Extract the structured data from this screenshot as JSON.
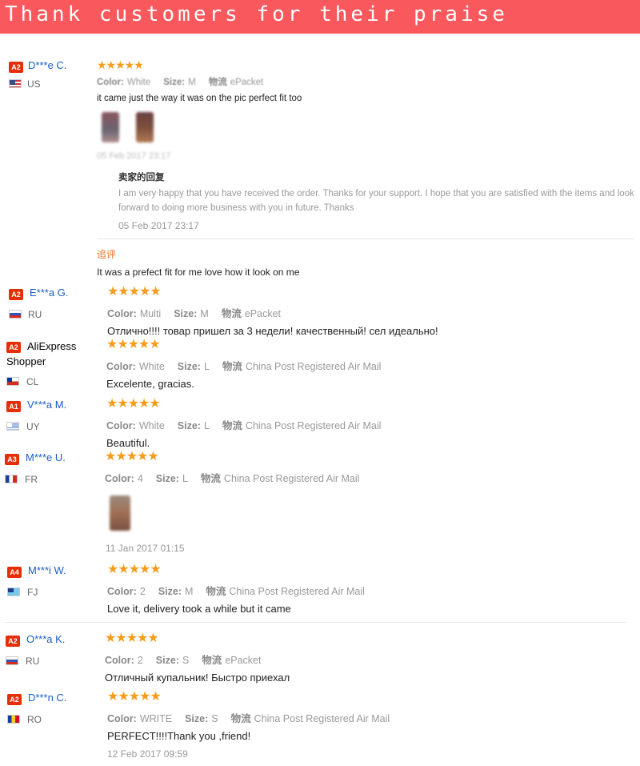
{
  "banner": {
    "title": "Thank customers for their praise"
  },
  "labels": {
    "color": "Color:",
    "size": "Size:",
    "shipping": "物流"
  },
  "reviews": [
    {
      "badge": "A2",
      "name": "D***e C.",
      "country": "US",
      "stars": "★★★★★",
      "color": "White",
      "size": "M",
      "shipping": "ePacket",
      "text": "it came just the way it was on the pic perfect fit too",
      "date": "05 Feb 2017 23:17",
      "seller_reply": {
        "title": "卖家的回复",
        "text": "I am very happy that you have received the order. Thanks for your support. I hope that you are satisfied with the items and look forward to doing more business with you in future. Thanks",
        "date": "05 Feb 2017 23:17"
      },
      "follow_up": {
        "label": "追评",
        "text": "It was a prefect fit for me love how it look on me"
      }
    },
    {
      "badge": "A2",
      "name": "E***a G.",
      "country": "RU",
      "stars": "★★★★★",
      "color": "Multi",
      "size": "M",
      "shipping": "ePacket",
      "text": "Отлично!!!! товар пришел за 3 недели! качественный! сел идеально!"
    },
    {
      "badge": "A2",
      "name": "AliExpress Shopper",
      "name_line1": "AliExpress",
      "name_line2": "Shopper",
      "country": "CL",
      "stars": "★★★★★",
      "color": "White",
      "size": "L",
      "shipping": "China Post Registered Air Mail",
      "text": "Excelente, gracias."
    },
    {
      "badge": "A1",
      "name": "V***a M.",
      "country": "UY",
      "stars": "★★★★★",
      "color": "White",
      "size": "L",
      "shipping": "China Post Registered Air Mail",
      "text": "Beautiful."
    },
    {
      "badge": "A3",
      "name": "M***e U.",
      "country": "FR",
      "stars": "★★★★★",
      "color": "4",
      "size": "L",
      "shipping": "China Post Registered Air Mail",
      "date": "11 Jan 2017 01:15"
    },
    {
      "badge": "A4",
      "name": "M***i W.",
      "country": "FJ",
      "stars": "★★★★★",
      "color": "2",
      "size": "M",
      "shipping": "China Post Registered Air Mail",
      "text": "Love it, delivery took a while but it came"
    },
    {
      "badge": "A2",
      "name": "O***a K.",
      "country": "RU",
      "stars": "★★★★★",
      "color": "2",
      "size": "S",
      "shipping": "ePacket",
      "text": "Отличный купальник! Быстро приехал"
    },
    {
      "badge": "A2",
      "name": "D***n C.",
      "country": "RO",
      "stars": "★★★★★",
      "color": "WRITE",
      "size": "S",
      "shipping": "China Post Registered Air Mail",
      "text": "PERFECT!!!!Thank you ,friend!",
      "date": "12 Feb 2017 09:59"
    }
  ]
}
